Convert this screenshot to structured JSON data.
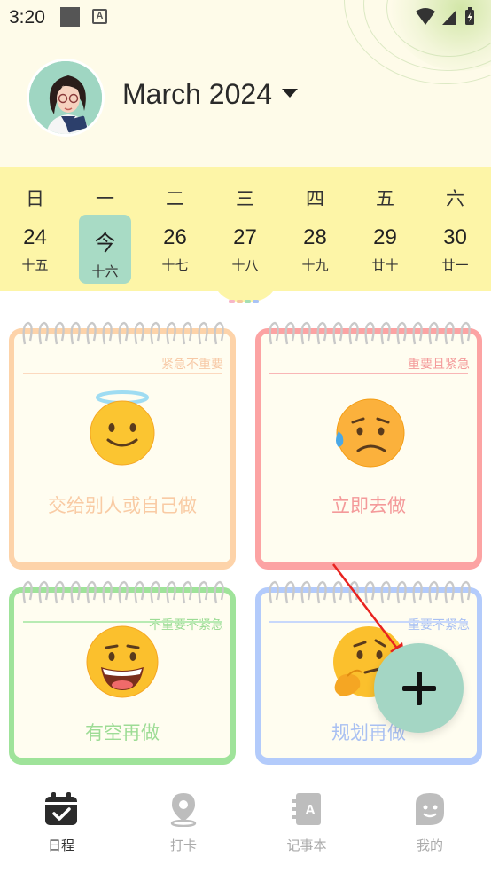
{
  "status_bar": {
    "time": "3:20",
    "a_icon_text": "A"
  },
  "header": {
    "month_title": "March 2024",
    "avatar_icon": "avatar-icon",
    "dropdown_icon": "caret-down-icon"
  },
  "week": {
    "days": [
      {
        "name": "日",
        "num": "24",
        "lunar": "十五",
        "today": false
      },
      {
        "name": "一",
        "num": "今",
        "lunar": "十六",
        "today": true
      },
      {
        "name": "二",
        "num": "26",
        "lunar": "十七",
        "today": false
      },
      {
        "name": "三",
        "num": "27",
        "lunar": "十八",
        "today": false
      },
      {
        "name": "四",
        "num": "28",
        "lunar": "十九",
        "today": false
      },
      {
        "name": "五",
        "num": "29",
        "lunar": "廿十",
        "today": false
      },
      {
        "name": "六",
        "num": "30",
        "lunar": "廿一",
        "today": false
      }
    ]
  },
  "quadrants": [
    {
      "tag": "紧急不重要",
      "title": "交给别人或自己做",
      "color": "#fdd3a9",
      "text_color": "#f8c8a2",
      "emoji": "halo-smile-emoji"
    },
    {
      "tag": "重要且紧急",
      "title": "立即去做",
      "color": "#fca3a3",
      "text_color": "#f49a9a",
      "emoji": "worried-sweat-emoji"
    },
    {
      "tag": "不重要不紧急",
      "title": "有空再做",
      "color": "#9fe39a",
      "text_color": "#9ddc95",
      "emoji": "grin-emoji"
    },
    {
      "tag": "重要不紧急",
      "title": "规划再做",
      "color": "#b3cbfb",
      "text_color": "#a9c0f2",
      "emoji": "thinking-emoji"
    }
  ],
  "fab": {
    "icon": "plus-icon"
  },
  "nav": [
    {
      "label": "日程",
      "icon": "calendar-check-icon",
      "active": true
    },
    {
      "label": "打卡",
      "icon": "location-pin-icon",
      "active": false
    },
    {
      "label": "记事本",
      "icon": "notebook-icon",
      "active": false
    },
    {
      "label": "我的",
      "icon": "profile-icon",
      "active": false
    }
  ],
  "colors": {
    "accent_green": "#a4d6c4",
    "week_yellow": "#fdf5a7",
    "header_cream": "#fefbe9"
  }
}
